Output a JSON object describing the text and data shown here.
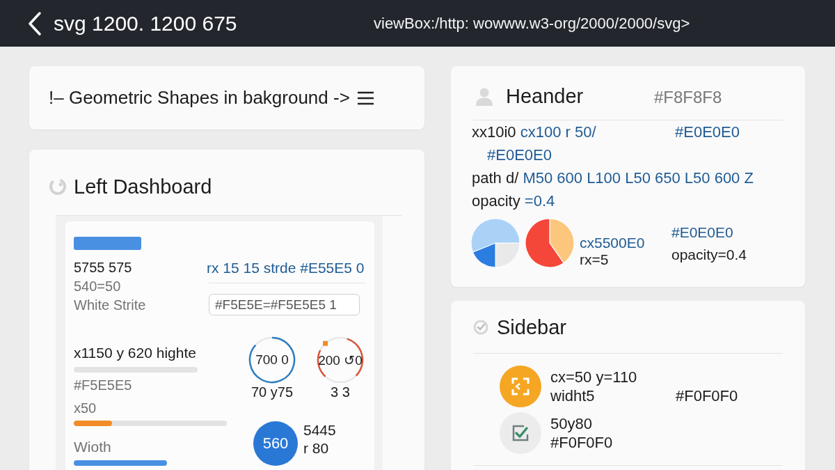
{
  "top_bar": {
    "title": "svg 1200. 1200 675",
    "address": "viewBox:/http: wowww.w3-org/2000/2000/svg>"
  },
  "banner": {
    "text": "!– Geometric Shapes in bakground ->"
  },
  "left_dashboard": {
    "title": "Left Dashboard",
    "stats": [
      {
        "text": "5755 575",
        "muted": false
      },
      {
        "text": "540=50",
        "muted": true
      },
      {
        "text": "White Strite",
        "muted": true
      }
    ],
    "code": "rx 15 15 strde #E55E5 0",
    "input": {
      "value": "#F5E5E=#F5E5E5 1"
    },
    "meters": [
      {
        "kind": "skeleton",
        "label": "x1150 y 620 highte"
      },
      {
        "kind": "note",
        "label": "#F5E5E5"
      },
      {
        "kind": "progress",
        "label": "x50",
        "level": 0.25,
        "color": "#f28c28"
      },
      {
        "kind": "bar",
        "label": "Wioth",
        "color": "#4a90e2"
      }
    ],
    "rings": [
      {
        "kind": "gauge",
        "value": "700 0",
        "caption": "70 y75",
        "color": "#2f7fc1"
      },
      {
        "kind": "split",
        "value": "200 ↺0",
        "caption": "3 3",
        "color": "#d9553a"
      }
    ],
    "badge": {
      "value": "560",
      "lines": [
        "5445",
        "r 80"
      ]
    }
  },
  "header_panel": {
    "title": "Heander",
    "note": "#F8F8F8",
    "lines": [
      {
        "kind": "main",
        "segments": [
          {
            "text": "xx10i0",
            "kind": "plain"
          },
          {
            "text": "cx100 r 50/",
            "kind": "value"
          }
        ],
        "aside": "#E0E0E0"
      },
      {
        "kind": "sub",
        "segments": [
          {
            "text": "#E0E0E0",
            "kind": "value"
          }
        ]
      },
      {
        "kind": "main",
        "segments": [
          {
            "text": "path d/",
            "kind": "plain"
          },
          {
            "text": "M50 600 L100 L50 650 L50 600 Z",
            "kind": "value"
          }
        ]
      },
      {
        "kind": "main",
        "segments": [
          {
            "text": "opacity",
            "kind": "plain"
          },
          {
            "text": "=0.4",
            "kind": "value"
          }
        ]
      }
    ],
    "legend": [
      [
        {
          "text": "cx5500E0",
          "kind": "value"
        },
        {
          "text": "rx=5",
          "kind": "plain"
        }
      ],
      [
        {
          "text": "#E0E0E0",
          "kind": "value"
        },
        {
          "text": "opacity=0.4",
          "kind": "plain"
        }
      ]
    ]
  },
  "sidebar": {
    "title": "Sidebar",
    "items": [
      {
        "kind": "scan",
        "lines": [
          "cx=50 y=110",
          "widht5"
        ],
        "note": "#F0F0F0"
      },
      {
        "kind": "check",
        "lines": [
          "50y80",
          "#F0F0F0"
        ]
      }
    ]
  }
}
